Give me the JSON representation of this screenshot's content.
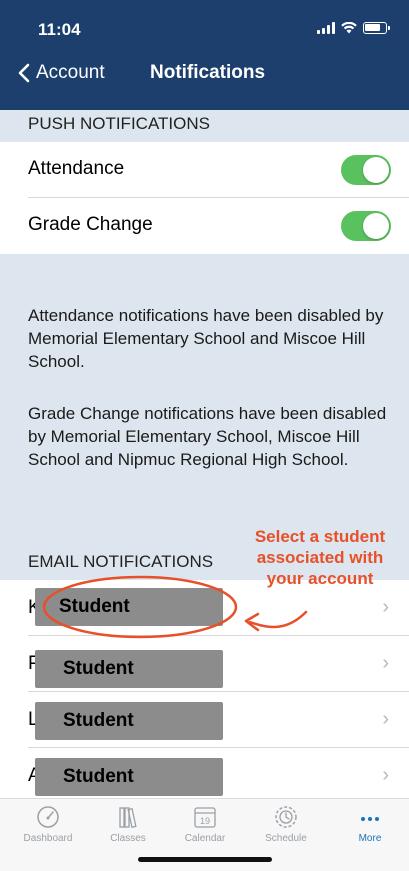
{
  "status_bar": {
    "time": "11:04"
  },
  "nav": {
    "back_label": "Account",
    "title": "Notifications"
  },
  "push": {
    "header": "PUSH NOTIFICATIONS",
    "rows": [
      {
        "label": "Attendance",
        "enabled": true
      },
      {
        "label": "Grade Change",
        "enabled": true
      }
    ],
    "notes": [
      "Attendance notifications have been disabled by Memorial Elementary School and Miscoe Hill School.",
      "Grade Change notifications have been disabled by Memorial Elementary School, Miscoe Hill School and Nipmuc Regional High School."
    ]
  },
  "email": {
    "header": "EMAIL NOTIFICATIONS",
    "students": [
      {
        "initial": "K",
        "label": "Student"
      },
      {
        "initial": "P",
        "label": "Student"
      },
      {
        "initial": "L",
        "label": "Student"
      },
      {
        "initial": "A",
        "label": "Student"
      }
    ]
  },
  "annotation": {
    "text": "Select a student associated with your account",
    "color": "#e8502a"
  },
  "tabbar": {
    "tabs": [
      {
        "label": "Dashboard",
        "icon": "gauge-icon",
        "active": false
      },
      {
        "label": "Classes",
        "icon": "books-icon",
        "active": false
      },
      {
        "label": "Calendar",
        "icon": "calendar-icon",
        "active": false,
        "calendar_day": "19"
      },
      {
        "label": "Schedule",
        "icon": "clock-icon",
        "active": false
      },
      {
        "label": "More",
        "icon": "more-dots-icon",
        "active": true
      }
    ]
  },
  "colors": {
    "navbar": "#1c3f6e",
    "toggle_on": "#5ac15f",
    "section_bg": "#dde6ee",
    "active_tab": "#1a73b8"
  }
}
